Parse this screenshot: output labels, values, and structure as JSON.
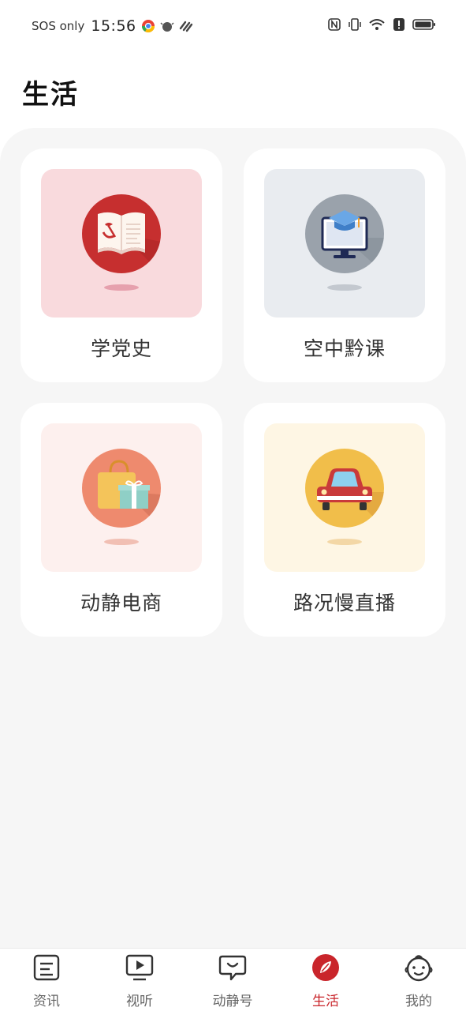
{
  "status_bar": {
    "carrier": "SOS only",
    "time": "15:56",
    "left_icons": [
      "chrome-icon",
      "android-bug-icon",
      "stripes-icon"
    ],
    "right_icons": [
      "nfc-icon",
      "vibrate-icon",
      "wifi-icon",
      "alert-icon",
      "battery-icon"
    ]
  },
  "page": {
    "title": "生活"
  },
  "cards": [
    {
      "label": "学党史",
      "icon": "party-history-book-icon",
      "bg": "#f9dadd",
      "circle": "#c62f2f"
    },
    {
      "label": "空中黔课",
      "icon": "online-class-monitor-icon",
      "bg": "#e9ecf0",
      "circle": "#9aa2ab"
    },
    {
      "label": "动静电商",
      "icon": "shopping-bag-gift-icon",
      "bg": "#fdf0ee",
      "circle": "#ee8a6e"
    },
    {
      "label": "路况慢直播",
      "icon": "car-traffic-icon",
      "bg": "#fef6e4",
      "circle": "#f1be4a"
    }
  ],
  "bottom_nav": {
    "active_index": 3,
    "accent": "#c9252b",
    "items": [
      {
        "label": "资讯",
        "icon": "news-document-icon"
      },
      {
        "label": "视听",
        "icon": "video-play-icon"
      },
      {
        "label": "动静号",
        "icon": "chat-bubble-smile-icon"
      },
      {
        "label": "生活",
        "icon": "compass-leaf-icon"
      },
      {
        "label": "我的",
        "icon": "profile-avatar-icon"
      }
    ]
  }
}
